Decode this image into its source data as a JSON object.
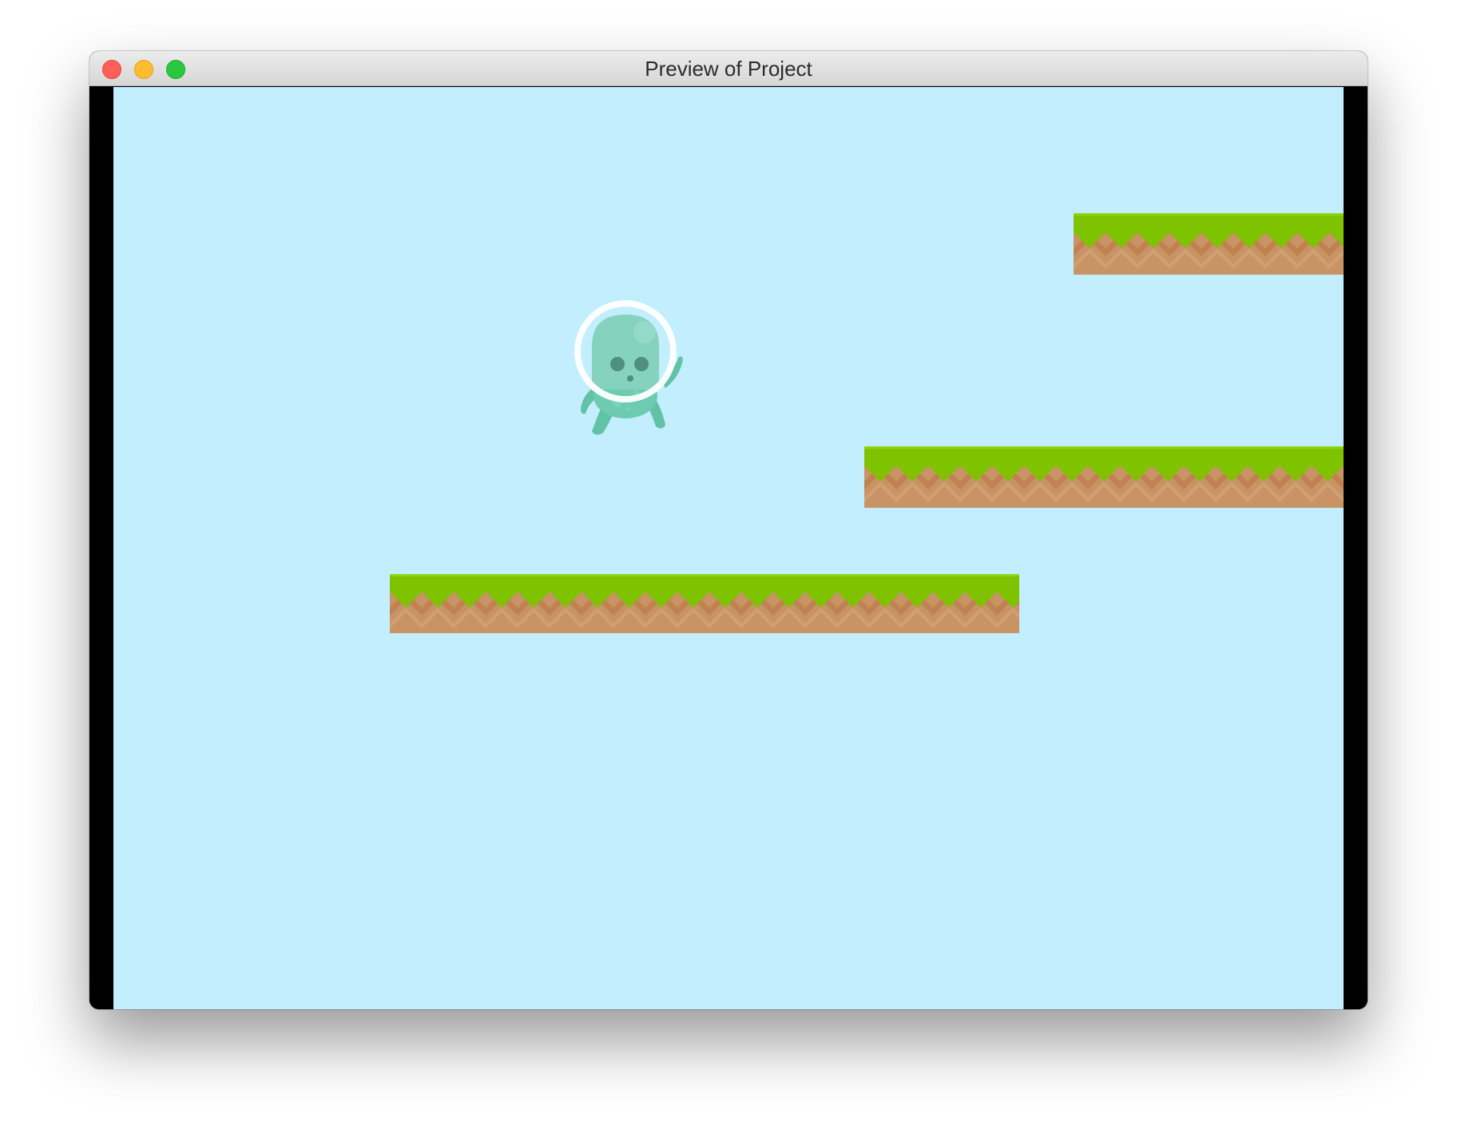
{
  "window": {
    "title": "Preview of Project"
  },
  "colors": {
    "sky": "#c2eefd",
    "grass": "#7ec200",
    "dirt": "#c99465",
    "dirt_dark": "#b9733f",
    "player": "#6ccbb1",
    "helmet": "#ffffff",
    "letterbox": "#000000"
  },
  "scene": {
    "player_icon": "alien-astronaut",
    "platform_count": 3
  }
}
